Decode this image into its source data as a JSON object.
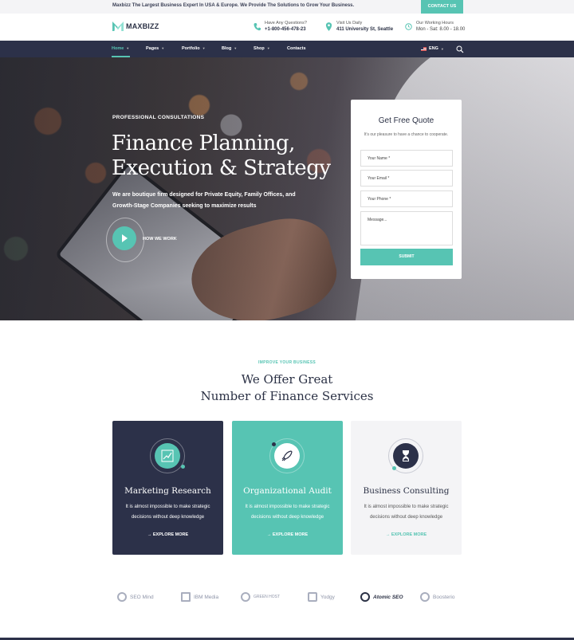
{
  "topbar": {
    "message": "Maxbizz The Largest Business Expert In USA & Europe. We Provide The Solutions to Grow Your Business.",
    "contact_button": "CONTACT US"
  },
  "header": {
    "logo_text": "MAXBIZZ",
    "phone": {
      "label": "Have Any Questions?",
      "value": "+1-800-456-478-23",
      "icon": "phone-icon"
    },
    "address": {
      "label": "Visit Us Daily",
      "value": "411 University St, Seattle",
      "icon": "location-pin-icon"
    },
    "hours": {
      "label": "Our Working Hours",
      "value": "Mon - Sat: 8.00 - 18.00",
      "icon": "clock-icon"
    }
  },
  "nav": {
    "items": [
      {
        "label": "Home",
        "active": true
      },
      {
        "label": "Pages"
      },
      {
        "label": "Portfolio"
      },
      {
        "label": "Blog"
      },
      {
        "label": "Shop"
      },
      {
        "label": "Contacts"
      }
    ],
    "language": "ENG",
    "search_icon": "search-icon"
  },
  "hero": {
    "kicker": "PROFESSIONAL CONSULTATIONS",
    "title_line1": "Finance Planning,",
    "title_line2": "Execution & Strategy",
    "subtitle": "We are boutique firm designed for Private Equity, Family Offices, and Growth-Stage Companies seeking to maximize results",
    "play_label": "HOW WE WORK"
  },
  "quote_form": {
    "title": "Get Free Quote",
    "subtitle": "It's our pleasure to have a chance to cooperate.",
    "name_placeholder": "Your Name *",
    "email_placeholder": "Your Email *",
    "phone_placeholder": "Your Phone *",
    "message_placeholder": "Message...",
    "submit": "SUBMIT"
  },
  "services": {
    "kicker": "IMPROVE YOUR BUSINESS",
    "title_line1": "We Offer Great",
    "title_line2": "Number of Finance Services",
    "cards": [
      {
        "title": "Marketing Research",
        "desc": "It is almost impossible to make strategic decisions without deep knowledge",
        "link": "EXPLORE MORE",
        "icon": "chart-icon"
      },
      {
        "title": "Organizational Audit",
        "desc": "It is almost impossible to make strategic decisions without deep knowledge",
        "link": "EXPLORE MORE",
        "icon": "rocket-icon"
      },
      {
        "title": "Business Consulting",
        "desc": "It is almost impossible to make strategic decisions without deep knowledge",
        "link": "EXPLORE MORE",
        "icon": "hourglass-icon"
      }
    ]
  },
  "brands": [
    "SEO Mind",
    "IBM Media",
    "GREEN HOST",
    "Yodgy",
    "Atomic SEO",
    "Boosterio"
  ],
  "colors": {
    "accent": "#57c4b3",
    "dark": "#2c3149",
    "light": "#f4f4f6"
  }
}
